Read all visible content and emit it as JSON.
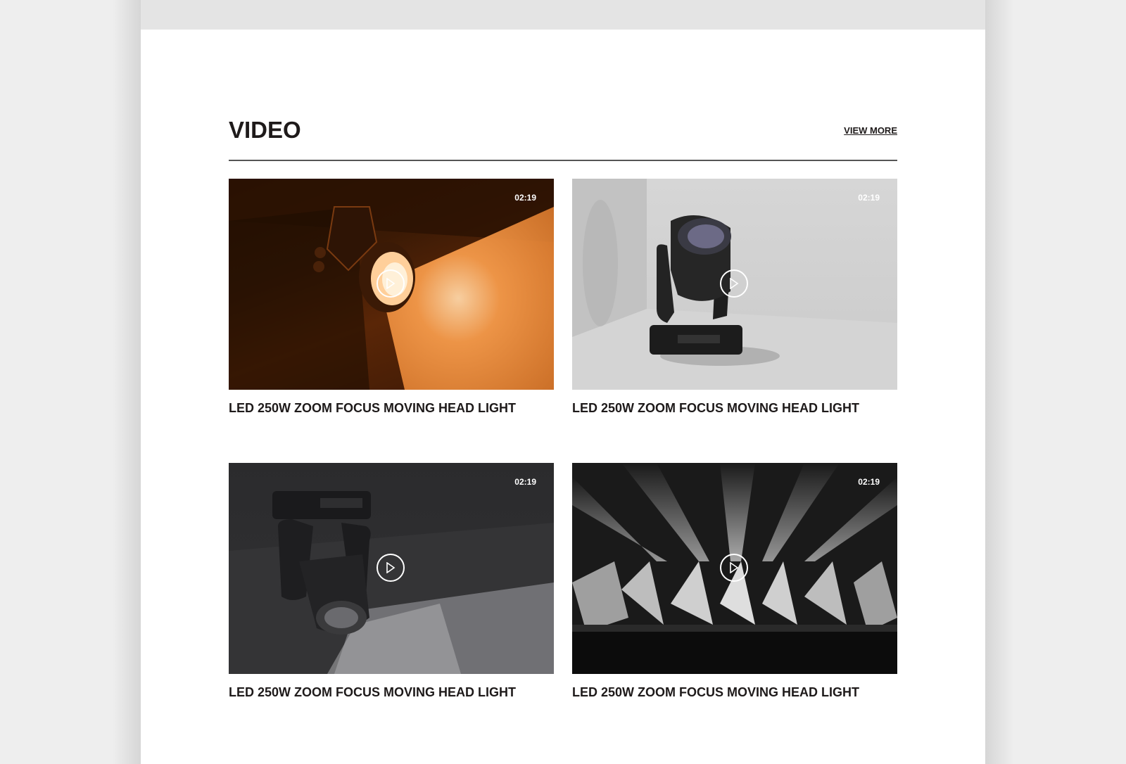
{
  "section": {
    "title": "VIDEO",
    "view_more": "VIEW MORE"
  },
  "videos": [
    {
      "title": "LED 250W ZOOM FOCUS MOVING HEAD LIGHT",
      "duration": "02:19",
      "thumb": "orange-spotlight"
    },
    {
      "title": "LED 250W ZOOM FOCUS MOVING HEAD LIGHT",
      "duration": "02:19",
      "thumb": "moving-head-grey-studio"
    },
    {
      "title": "LED 250W ZOOM FOCUS MOVING HEAD LIGHT",
      "duration": "02:19",
      "thumb": "moving-head-dark-beam"
    },
    {
      "title": "LED 250W ZOOM FOCUS MOVING HEAD LIGHT",
      "duration": "02:19",
      "thumb": "concert-light-show"
    }
  ],
  "icons": {
    "play": "play-icon"
  },
  "colors": {
    "text": "#1e1a1a",
    "background": "#ffffff",
    "accent_orange": "#f08a3a"
  }
}
